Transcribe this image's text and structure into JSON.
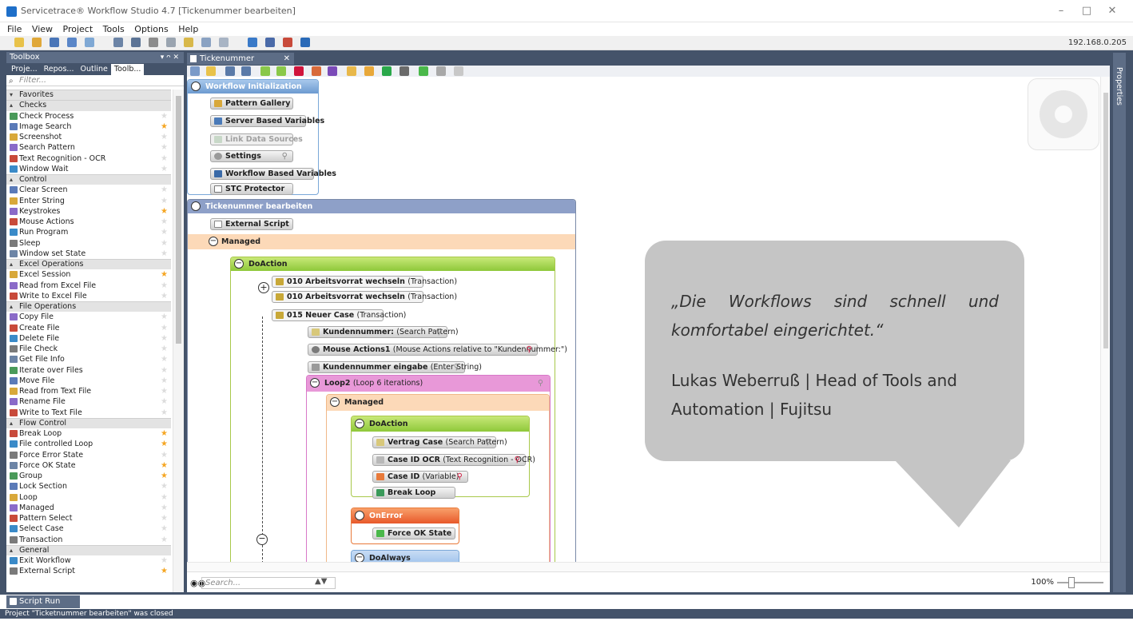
{
  "window": {
    "title": "Servicetrace® Workflow Studio 4.7  [Tickenummer bearbeiten]",
    "min": "–",
    "max": "□",
    "close": "✕"
  },
  "menu": [
    "File",
    "View",
    "Project",
    "Tools",
    "Options",
    "Help"
  ],
  "toolbar": {
    "ip": "192.168.0.205"
  },
  "toolbox": {
    "title": "Toolbox",
    "pin": "▾ ᴖ ✕",
    "tabs": [
      "Proje...",
      "Repos...",
      "Outline",
      "Toolb..."
    ],
    "filter": "Filter...",
    "groups": [
      {
        "label": "Favorites",
        "items": []
      },
      {
        "label": "Checks",
        "items": [
          {
            "label": "Check Process",
            "star": false
          },
          {
            "label": "Image Search",
            "star": true
          },
          {
            "label": "Screenshot",
            "star": false
          },
          {
            "label": "Search Pattern",
            "star": false
          },
          {
            "label": "Text Recognition - OCR",
            "star": false
          },
          {
            "label": "Window Wait",
            "star": false
          }
        ]
      },
      {
        "label": "Control",
        "items": [
          {
            "label": "Clear Screen",
            "star": false
          },
          {
            "label": "Enter String",
            "star": false
          },
          {
            "label": "Keystrokes",
            "star": true
          },
          {
            "label": "Mouse Actions",
            "star": false
          },
          {
            "label": "Run Program",
            "star": false
          },
          {
            "label": "Sleep",
            "star": false
          },
          {
            "label": "Window set State",
            "star": false
          }
        ]
      },
      {
        "label": "Excel Operations",
        "items": [
          {
            "label": "Excel Session",
            "star": true
          },
          {
            "label": "Read from Excel File",
            "star": false
          },
          {
            "label": "Write to Excel File",
            "star": false
          }
        ]
      },
      {
        "label": "File Operations",
        "items": [
          {
            "label": "Copy File",
            "star": false
          },
          {
            "label": "Create File",
            "star": false
          },
          {
            "label": "Delete File",
            "star": false
          },
          {
            "label": "File Check",
            "star": false
          },
          {
            "label": "Get File Info",
            "star": false
          },
          {
            "label": "Iterate over Files",
            "star": false
          },
          {
            "label": "Move File",
            "star": false
          },
          {
            "label": "Read from Text File",
            "star": false
          },
          {
            "label": "Rename File",
            "star": false
          },
          {
            "label": "Write to Text File",
            "star": false
          }
        ]
      },
      {
        "label": "Flow Control",
        "items": [
          {
            "label": "Break Loop",
            "star": true
          },
          {
            "label": "File controlled Loop",
            "star": true
          },
          {
            "label": "Force Error State",
            "star": false
          },
          {
            "label": "Force OK State",
            "star": true
          },
          {
            "label": "Group",
            "star": true
          },
          {
            "label": "Lock Section",
            "star": false
          },
          {
            "label": "Loop",
            "star": false
          },
          {
            "label": "Managed",
            "star": false
          },
          {
            "label": "Pattern Select",
            "star": false
          },
          {
            "label": "Select Case",
            "star": false
          },
          {
            "label": "Transaction",
            "star": false
          }
        ]
      },
      {
        "label": "General",
        "items": [
          {
            "label": "Exit Workflow",
            "star": false
          },
          {
            "label": "External Script",
            "star": true
          }
        ]
      }
    ]
  },
  "document": {
    "tab": "Tickenummer bearbeiten",
    "init": {
      "title": "Workflow Initialization",
      "items": [
        "Pattern Gallery",
        "Server Based Variables",
        "Link Data Sources",
        "Settings",
        "Workflow Based Variables",
        "STC Protector"
      ]
    },
    "main": {
      "title": "Tickenummer bearbeiten",
      "ext": "External Script",
      "managed": "Managed",
      "doaction": "DoAction",
      "t1": "010 Arbeitsvorrat wechseln",
      "t1s": "(Transaction)",
      "t2": "010 Arbeitsvorrat wechseln",
      "t2s": "(Transaction)",
      "t3": "015 Neuer Case",
      "t3s": "(Transaction)",
      "a1": "Kundennummer:",
      "a1s": "(Search Pattern)",
      "a2": "Mouse Actions1",
      "a2s": "(Mouse Actions relative to \"Kundennummer:\")",
      "a3": "Kundennummer eingabe",
      "a3s": "(Enter String)",
      "loop": "Loop2",
      "loops": "(Loop 6 iterations)",
      "managed2": "Managed",
      "doaction2": "DoAction",
      "b1": "Vertrag Case",
      "b1s": "(Search Pattern)",
      "b2": "Case ID OCR",
      "b2s": "(Text Recognition - OCR)",
      "b3": "Case ID",
      "b3s": "(Variable)",
      "b4": "Break Loop",
      "onerror": "OnError",
      "forceok": "Force OK State",
      "doalways": "DoAlways"
    }
  },
  "quote": {
    "text": "„Die Workflows sind schnell und komfortabel eingerichtet.“",
    "author": "Lukas Weberruß | Head of Tools and Automation | Fujitsu"
  },
  "search": {
    "placeholder": "Search...",
    "zoom": "100%"
  },
  "props": {
    "label": "Properties"
  },
  "bottom": {
    "tab": "Script Run Results"
  },
  "status": {
    "text": "Project \"Ticketnummer bearbeiten\" was closed"
  }
}
